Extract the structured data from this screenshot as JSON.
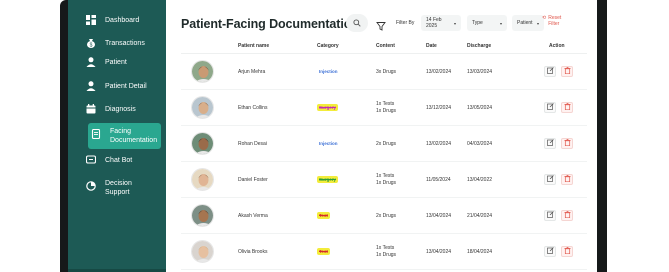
{
  "sidebar": {
    "items": [
      {
        "label": "Dashboard",
        "icon": "dashboard-grid-icon"
      },
      {
        "label": "Transactions",
        "icon": "money-bag-icon"
      },
      {
        "label": "Patient",
        "icon": "person-icon"
      },
      {
        "label": "Patient Detail",
        "icon": "person-detail-icon"
      },
      {
        "label": "Diagnosis",
        "icon": "calendar-icon"
      },
      {
        "label": "Facing Documentation",
        "label_line1": "Facing",
        "label_line2": "Documentation",
        "icon": "document-icon",
        "active": true
      },
      {
        "label": "Chat Bot",
        "icon": "chat-icon"
      },
      {
        "label": "Decision Support",
        "label_line1": "Decision",
        "label_line2": "Support",
        "icon": "pie-chart-icon"
      }
    ]
  },
  "header": {
    "title": "Patient-Facing Documentation",
    "filter_label": "Filter By",
    "date_filter": "14 Feb 2025",
    "type_filter": "Type",
    "patient_filter": "Patient",
    "reset_line1": "Reset",
    "reset_line2": "Filter"
  },
  "table": {
    "columns": {
      "patient_name": "Patient name",
      "category": "Category",
      "content": "Content",
      "date": "Date",
      "discharge": "Discharge",
      "action": "Action"
    },
    "rows": [
      {
        "name": "Arjun Mehra",
        "category": "Injection",
        "content1": "3x Drugs",
        "content2": "",
        "date": "13/02/2024",
        "discharge": "13/03/2024"
      },
      {
        "name": "Ethan Collins",
        "category": "Surgery",
        "content1": "1x Tests",
        "content2": "1x Drugs",
        "date": "13/12/2024",
        "discharge": "13/05/2024"
      },
      {
        "name": "Rohan Desai",
        "category": "Injection",
        "content1": "2x Drugs",
        "content2": "",
        "date": "13/02/2024",
        "discharge": "04/03/2024"
      },
      {
        "name": "Daniel Foster",
        "category": "Surgery",
        "content1": "1x Tests",
        "content2": "1x Drugs",
        "date": "11/05/2024",
        "discharge": "13/04/2022"
      },
      {
        "name": "Akash Verma",
        "category": "Test",
        "content1": "2x Drugs",
        "content2": "",
        "date": "13/04/2024",
        "discharge": "21/04/2024"
      },
      {
        "name": "Olivia Brooks",
        "category": "Test",
        "content1": "1x Tests",
        "content2": "1x Drugs",
        "date": "13/04/2024",
        "discharge": "18/04/2024"
      }
    ]
  },
  "colors": {
    "sidebar_bg": "#1d5a55",
    "active_item": "#2aa790",
    "injection": "#3b6fd6",
    "surgery": "#c42bb5",
    "surgery_green": "#2e9e3a",
    "test": "#d62c2c",
    "highlight": "#f3ec3a",
    "delete": "#e0554a"
  }
}
